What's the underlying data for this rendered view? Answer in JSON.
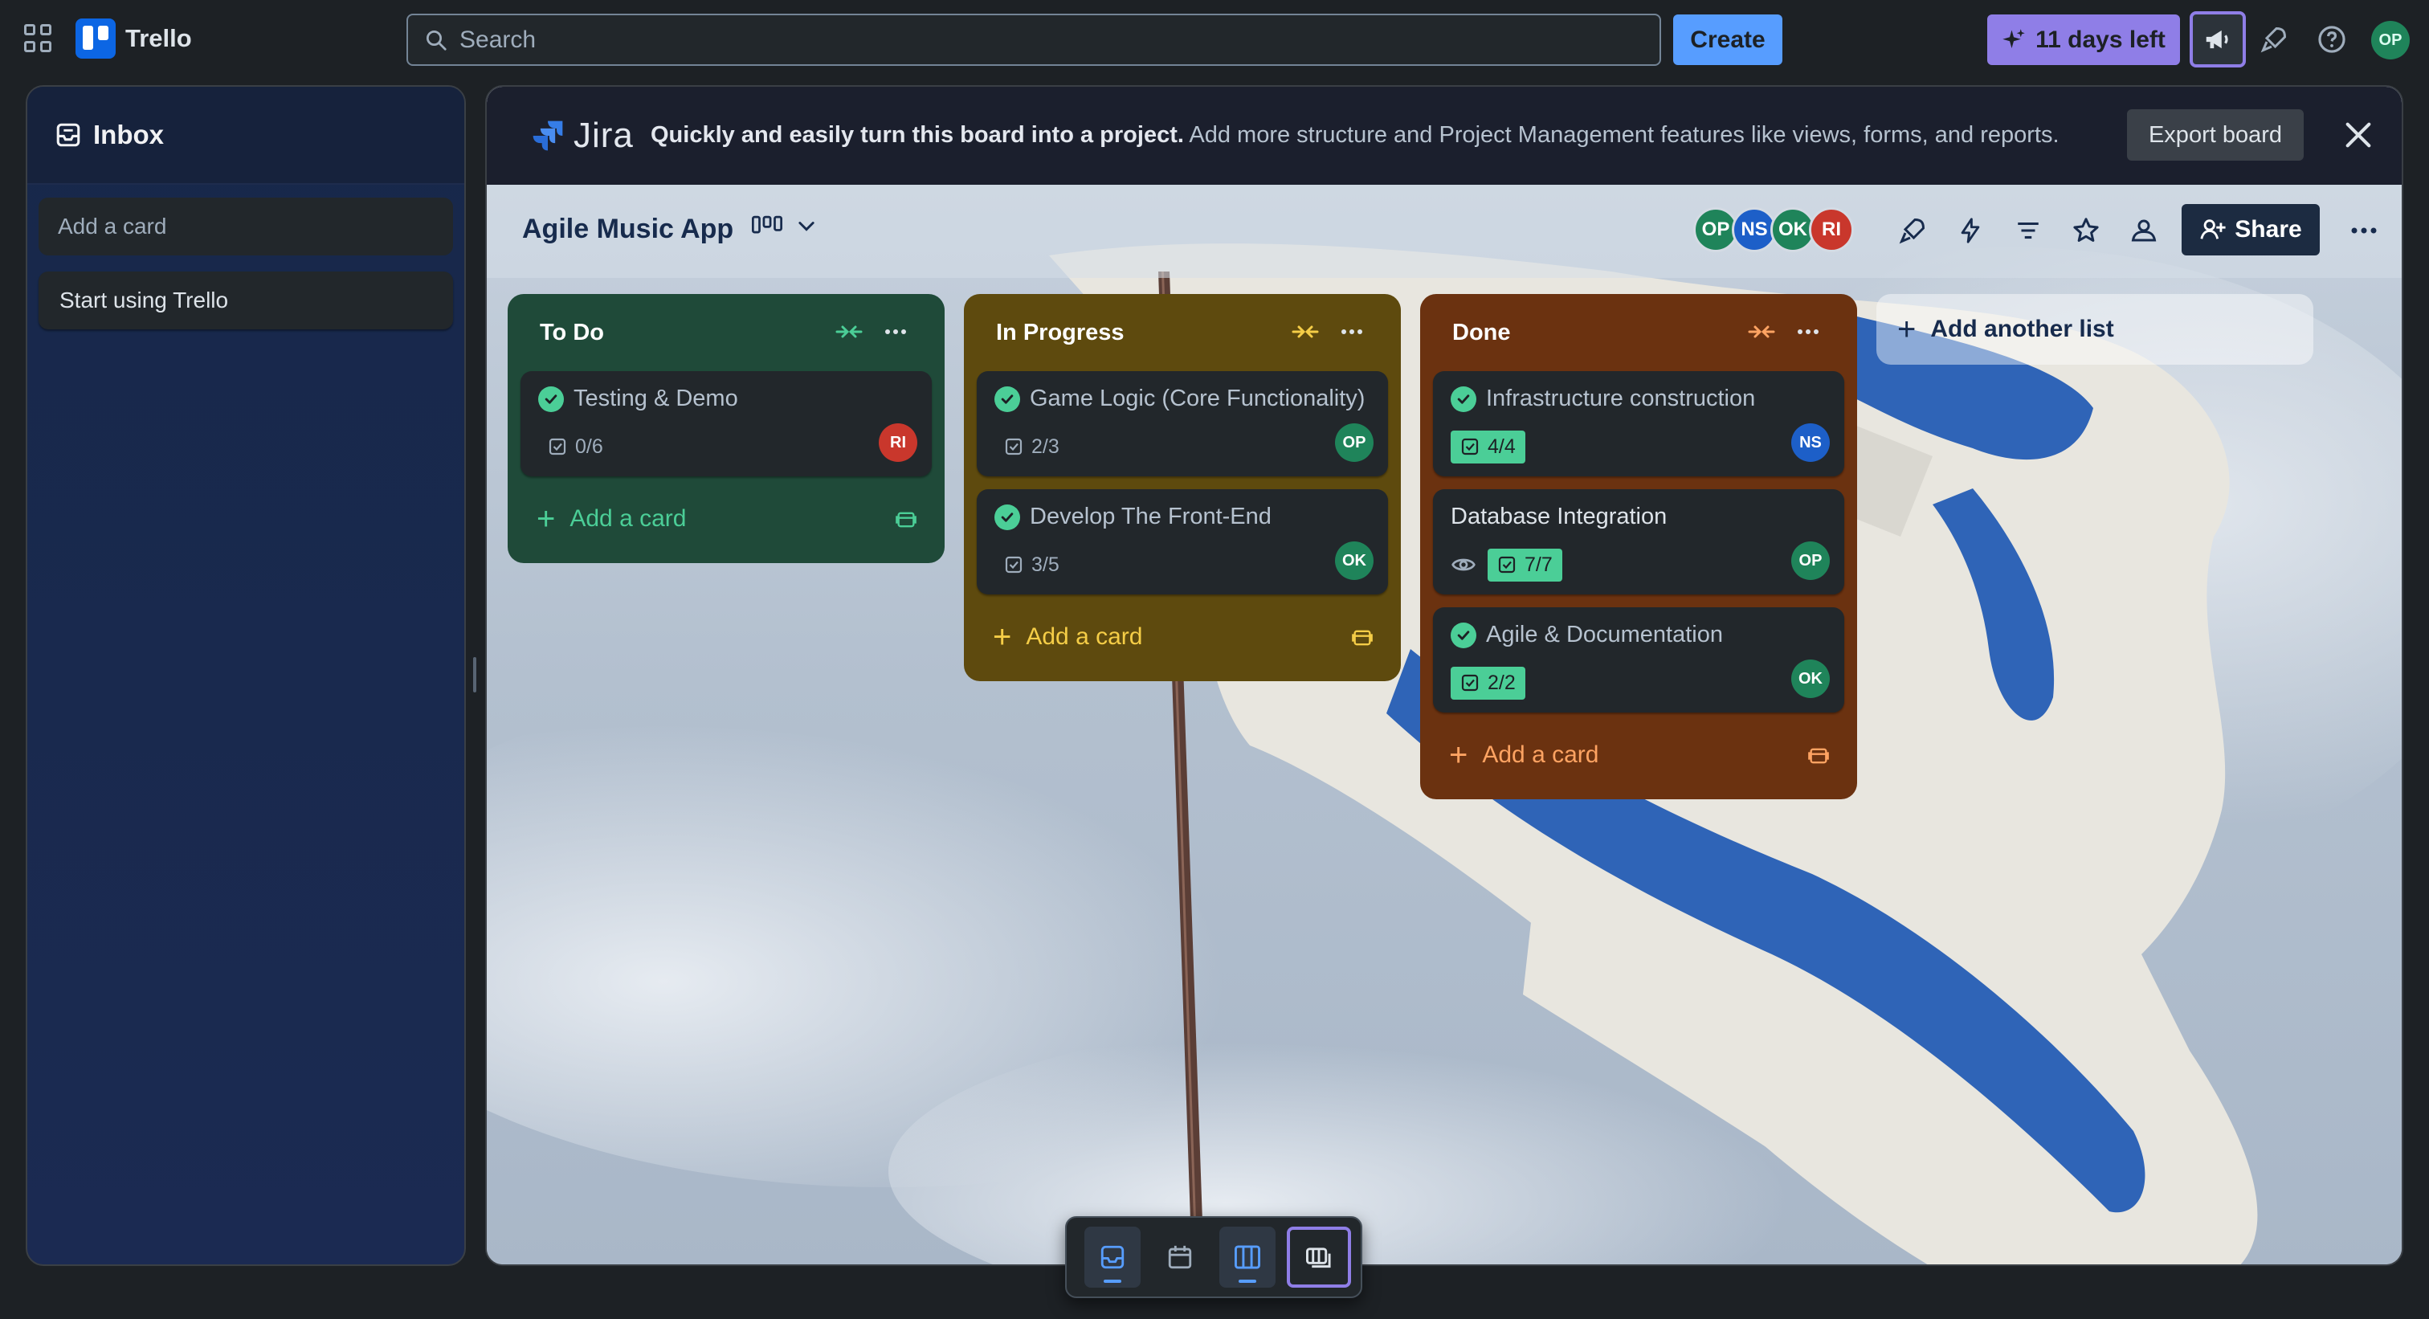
{
  "app": {
    "name": "Trello"
  },
  "search": {
    "placeholder": "Search"
  },
  "topbar": {
    "create_label": "Create",
    "trial_label": "11 days left",
    "user_initials": "OP"
  },
  "inbox": {
    "title": "Inbox",
    "add_placeholder": "Add a card",
    "cards": [
      "Start using Trello"
    ]
  },
  "jira_banner": {
    "brand": "Jira",
    "headline": "Quickly and easily turn this board into a project.",
    "message": " Add more structure and Project Management features like views, forms, and reports.",
    "export_label": "Export board"
  },
  "board": {
    "title": "Agile Music App",
    "members": [
      {
        "initials": "OP",
        "color": "#1f845a"
      },
      {
        "initials": "NS",
        "color": "#1d5fc8"
      },
      {
        "initials": "OK",
        "color": "#1f845a"
      },
      {
        "initials": "RI",
        "color": "#c9372c"
      }
    ],
    "share_label": "Share",
    "add_list_label": "Add another list"
  },
  "lists": [
    {
      "title": "To Do",
      "color": "#1f4a39",
      "add_label": "Add a card",
      "cards": [
        {
          "title": "Testing & Demo",
          "done": true,
          "checklist": "0/6",
          "checklist_complete": false,
          "member": "RI"
        }
      ]
    },
    {
      "title": "In Progress",
      "color": "#5e4a0e",
      "add_label": "Add a card",
      "cards": [
        {
          "title": "Game Logic (Core Functionality)",
          "done": true,
          "checklist": "2/3",
          "checklist_complete": false,
          "member": "OP"
        },
        {
          "title": "Develop The Front-End",
          "done": true,
          "checklist": "3/5",
          "checklist_complete": false,
          "member": "OK"
        }
      ]
    },
    {
      "title": "Done",
      "color": "#6b3210",
      "add_label": "Add a card",
      "cards": [
        {
          "title": "Infrastructure construction",
          "done": true,
          "checklist": "4/4",
          "checklist_complete": true,
          "member": "NS"
        },
        {
          "title": "Database Integration",
          "done": false,
          "watching": true,
          "checklist": "7/7",
          "checklist_complete": true,
          "member": "OP"
        },
        {
          "title": "Agile & Documentation",
          "done": true,
          "checklist": "2/2",
          "checklist_complete": true,
          "member": "OK"
        }
      ]
    }
  ],
  "colors": {
    "accent": "#579dff",
    "trial": "#8f7ee7",
    "complete": "#4bce97"
  },
  "icons": [
    "apps-grid-icon",
    "search-icon",
    "sparkle-icon",
    "megaphone-icon",
    "rocket-icon",
    "help-icon",
    "inbox-icon",
    "jira-icon",
    "close-icon",
    "board-view-icon",
    "chevron-down-icon",
    "power-up-icon",
    "automation-icon",
    "filter-icon",
    "star-icon",
    "visibility-icon",
    "add-user-icon",
    "more-icon",
    "collapse-icon",
    "template-icon",
    "checklist-icon",
    "eye-icon",
    "calendar-icon"
  ]
}
